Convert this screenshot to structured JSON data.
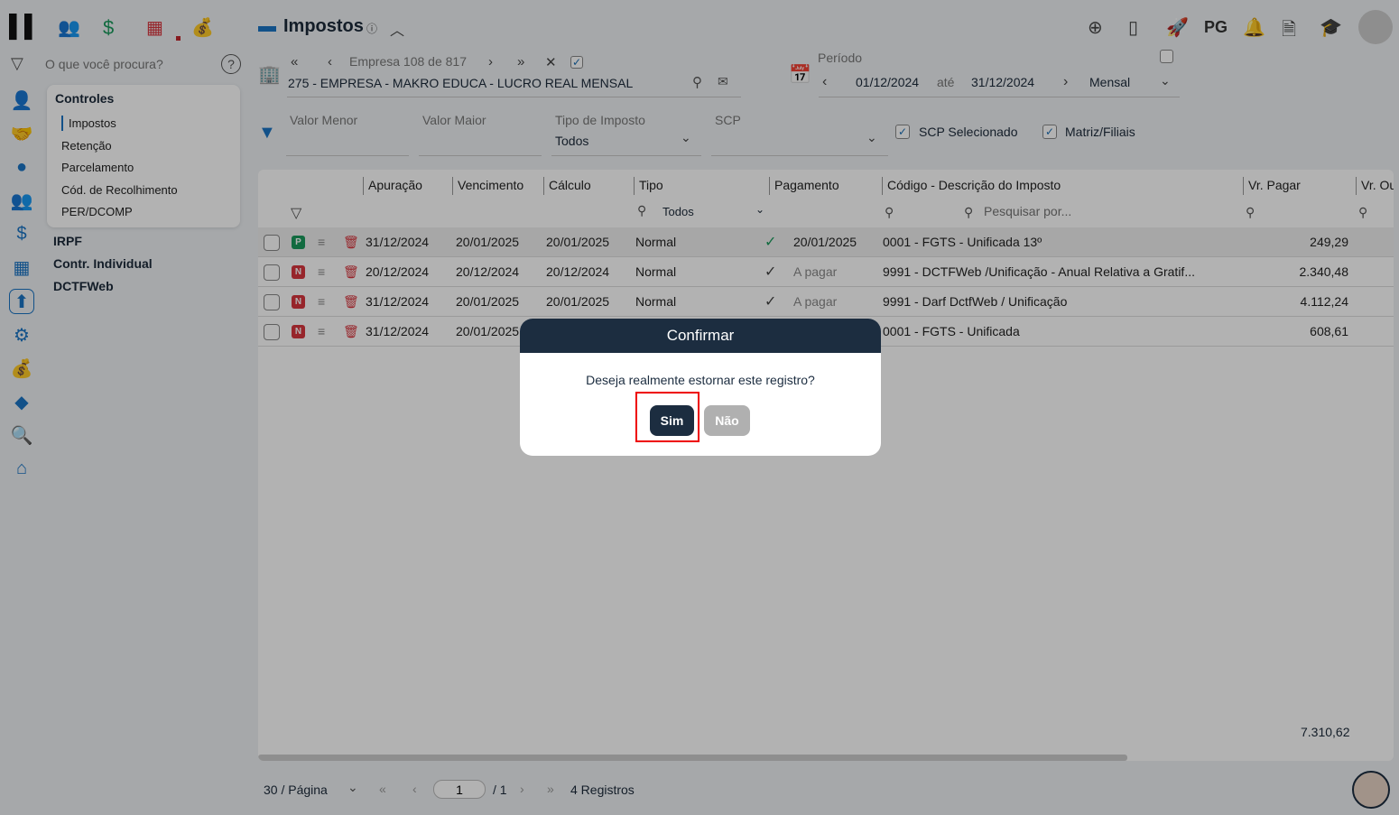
{
  "header": {
    "title": "Impostos",
    "top_icons": [
      "plus-circle-icon",
      "document-icon",
      "rocket-icon",
      "bell-icon",
      "report-search-icon",
      "graduation-cap-icon"
    ],
    "pg_label": "PG"
  },
  "app_tabs": [
    "people-icon",
    "dollar-icon",
    "calculator-icon",
    "money-bag-icon"
  ],
  "search": {
    "placeholder": "O que você procura?"
  },
  "sidebar": {
    "section": "Controles",
    "items": [
      "Impostos",
      "Retenção",
      "Parcelamento",
      "Cód. de Recolhimento",
      "PER/DCOMP"
    ],
    "groups": [
      "IRPF",
      "Contr. Individual",
      "DCTFWeb"
    ]
  },
  "company": {
    "nav_text": "Empresa 108 de 817",
    "name": "275 - EMPRESA - MAKRO EDUCA - LUCRO REAL MENSAL"
  },
  "period": {
    "label": "Período",
    "start": "01/12/2024",
    "sep": "até",
    "end": "31/12/2024",
    "mode": "Mensal"
  },
  "filters": {
    "valor_menor": "Valor Menor",
    "valor_maior": "Valor Maior",
    "tipo_label": "Tipo de Imposto",
    "tipo_value": "Todos",
    "scp_label": "SCP",
    "scp_selecionado": "SCP Selecionado",
    "matriz_filiais": "Matriz/Filiais"
  },
  "table": {
    "columns": [
      "Apuração",
      "Vencimento",
      "Cálculo",
      "Tipo",
      "Pagamento",
      "Código - Descrição do Imposto",
      "Vr. Pagar",
      "Vr. Ou"
    ],
    "tipo_filter": "Todos",
    "search_placeholder": "Pesquisar por...",
    "rows": [
      {
        "badge": "P",
        "apuracao": "31/12/2024",
        "vencimento": "20/01/2025",
        "calculo": "20/01/2025",
        "tipo": "Normal",
        "pagamento": "20/01/2025",
        "descricao": "0001 - FGTS - Unificada 13º",
        "valor": "249,29"
      },
      {
        "badge": "N",
        "apuracao": "20/12/2024",
        "vencimento": "20/12/2024",
        "calculo": "20/12/2024",
        "tipo": "Normal",
        "pagamento": "A pagar",
        "descricao": "9991 - DCTFWeb /Unificação - Anual Relativa a Gratif...",
        "valor": "2.340,48"
      },
      {
        "badge": "N",
        "apuracao": "31/12/2024",
        "vencimento": "20/01/2025",
        "calculo": "20/01/2025",
        "tipo": "Normal",
        "pagamento": "A pagar",
        "descricao": "9991 - Darf DctfWeb / Unificação",
        "valor": "4.112,24"
      },
      {
        "badge": "N",
        "apuracao": "31/12/2024",
        "vencimento": "20/01/2025",
        "calculo": "",
        "tipo": "",
        "pagamento": "",
        "descricao": "0001 - FGTS - Unificada",
        "valor": "608,61"
      }
    ],
    "total": "7.310,62"
  },
  "pagination": {
    "per_page": "30 / Página",
    "page": "1",
    "total_pages": "/ 1",
    "records": "4 Registros"
  },
  "dialog": {
    "title": "Confirmar",
    "message": "Deseja realmente estornar este registro?",
    "yes": "Sim",
    "no": "Não"
  },
  "colors": {
    "accent": "#1a75c4",
    "dialog_header": "#1c2d40",
    "badge_p": "#1a9a5c",
    "badge_n": "#d9363e"
  }
}
